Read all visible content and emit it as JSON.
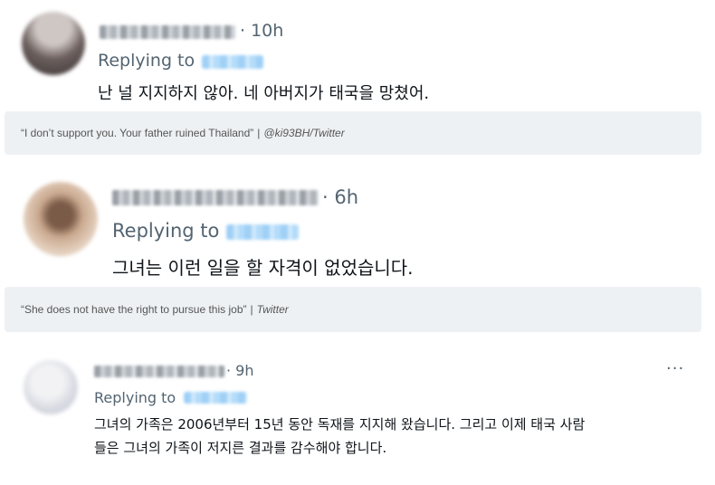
{
  "tweets": [
    {
      "time": "· 10h",
      "replying_to": "Replying to",
      "text": "난 널 지지하지 않아. 네 아버지가 태국을 망쳤어.",
      "caption_quote": "“I don’t support you. Your father ruined Thailand”",
      "caption_sep": "|",
      "caption_source": "@ki93BH/Twitter"
    },
    {
      "time": "· 6h",
      "replying_to": "Replying to",
      "text": "그녀는 이런 일을 할 자격이 없었습니다.",
      "caption_quote": "“She does not have the right to pursue this job”",
      "caption_sep": "|",
      "caption_source": "Twitter"
    },
    {
      "time": "· 9h",
      "replying_to": "Replying to",
      "text_line1": "그녀의 가족은 2006년부터 15년 동안 독재를 지지해 왔습니다.  그리고 이제 태국 사람",
      "text_line2": "들은 그녀의 가족이 저지른 결과를 감수해야 합니다.",
      "more": "···"
    }
  ],
  "colors": {
    "meta": "#536471",
    "caption_bg": "#eef1f4",
    "handle_blur": "#9fd0f6"
  }
}
